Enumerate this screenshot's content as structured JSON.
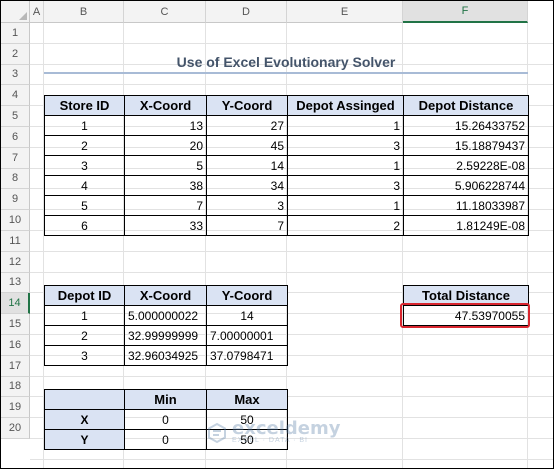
{
  "columns": [
    "A",
    "B",
    "C",
    "D",
    "E",
    "F"
  ],
  "rows": [
    "1",
    "2",
    "3",
    "4",
    "5",
    "6",
    "7",
    "8",
    "9",
    "10",
    "11",
    "12",
    "13",
    "14",
    "15",
    "16",
    "17",
    "18",
    "19",
    "20"
  ],
  "selected_col": "F",
  "selected_row": "14",
  "title": "Use of Excel Evolutionary Solver",
  "stores": {
    "headers": [
      "Store ID",
      "X-Coord",
      "Y-Coord",
      "Depot Assinged",
      "Depot Distance"
    ],
    "rows": [
      [
        "1",
        "13",
        "27",
        "1",
        "15.26433752"
      ],
      [
        "2",
        "20",
        "45",
        "3",
        "15.18879437"
      ],
      [
        "3",
        "5",
        "14",
        "1",
        "2.59228E-08"
      ],
      [
        "4",
        "38",
        "34",
        "3",
        "5.906228744"
      ],
      [
        "5",
        "7",
        "3",
        "1",
        "11.18033987"
      ],
      [
        "6",
        "33",
        "7",
        "2",
        "1.81249E-08"
      ]
    ]
  },
  "depots": {
    "headers": [
      "Depot ID",
      "X-Coord",
      "Y-Coord"
    ],
    "rows": [
      [
        "1",
        "5.000000022",
        "14"
      ],
      [
        "2",
        "32.99999999",
        "7.00000001"
      ],
      [
        "3",
        "32.96034925",
        "37.0798471"
      ]
    ]
  },
  "limits": {
    "headers": [
      "",
      "Min",
      "Max"
    ],
    "rows": [
      [
        "X",
        "0",
        "50"
      ],
      [
        "Y",
        "0",
        "50"
      ]
    ]
  },
  "total": {
    "label": "Total Distance",
    "value": "47.53970055"
  },
  "watermark": {
    "name": "exceldemy",
    "tagline": "EXCEL · DATA · BI"
  },
  "colors": {
    "header_fill": "#dae3f3",
    "title_color": "#44546a",
    "highlight": "#d9262f",
    "selection": "#217346"
  }
}
